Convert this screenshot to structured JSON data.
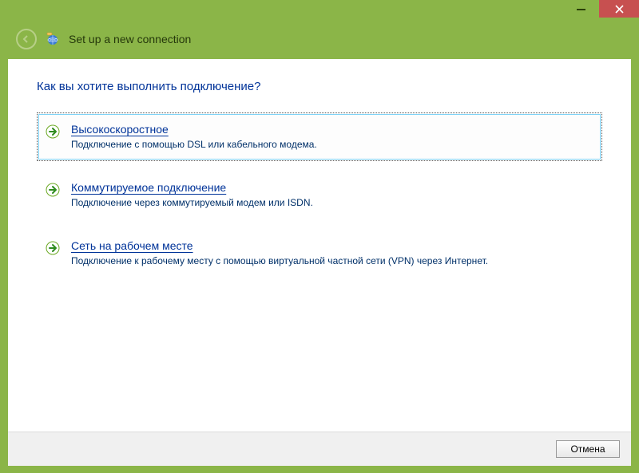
{
  "window": {
    "title": "Set up a new connection"
  },
  "main": {
    "question": "Как вы хотите выполнить подключение?"
  },
  "options": [
    {
      "title": "Высокоскоростное",
      "desc": "Подключение с помощью DSL или кабельного модема.",
      "selected": true
    },
    {
      "title": "Коммутируемое подключение",
      "desc": "Подключение через коммутируемый модем или ISDN.",
      "selected": false
    },
    {
      "title": "Сеть на рабочем месте",
      "desc": "Подключение к рабочему месту с помощью виртуальной частной сети (VPN) через Интернет.",
      "selected": false
    }
  ],
  "footer": {
    "cancel_label": "Отмена"
  }
}
